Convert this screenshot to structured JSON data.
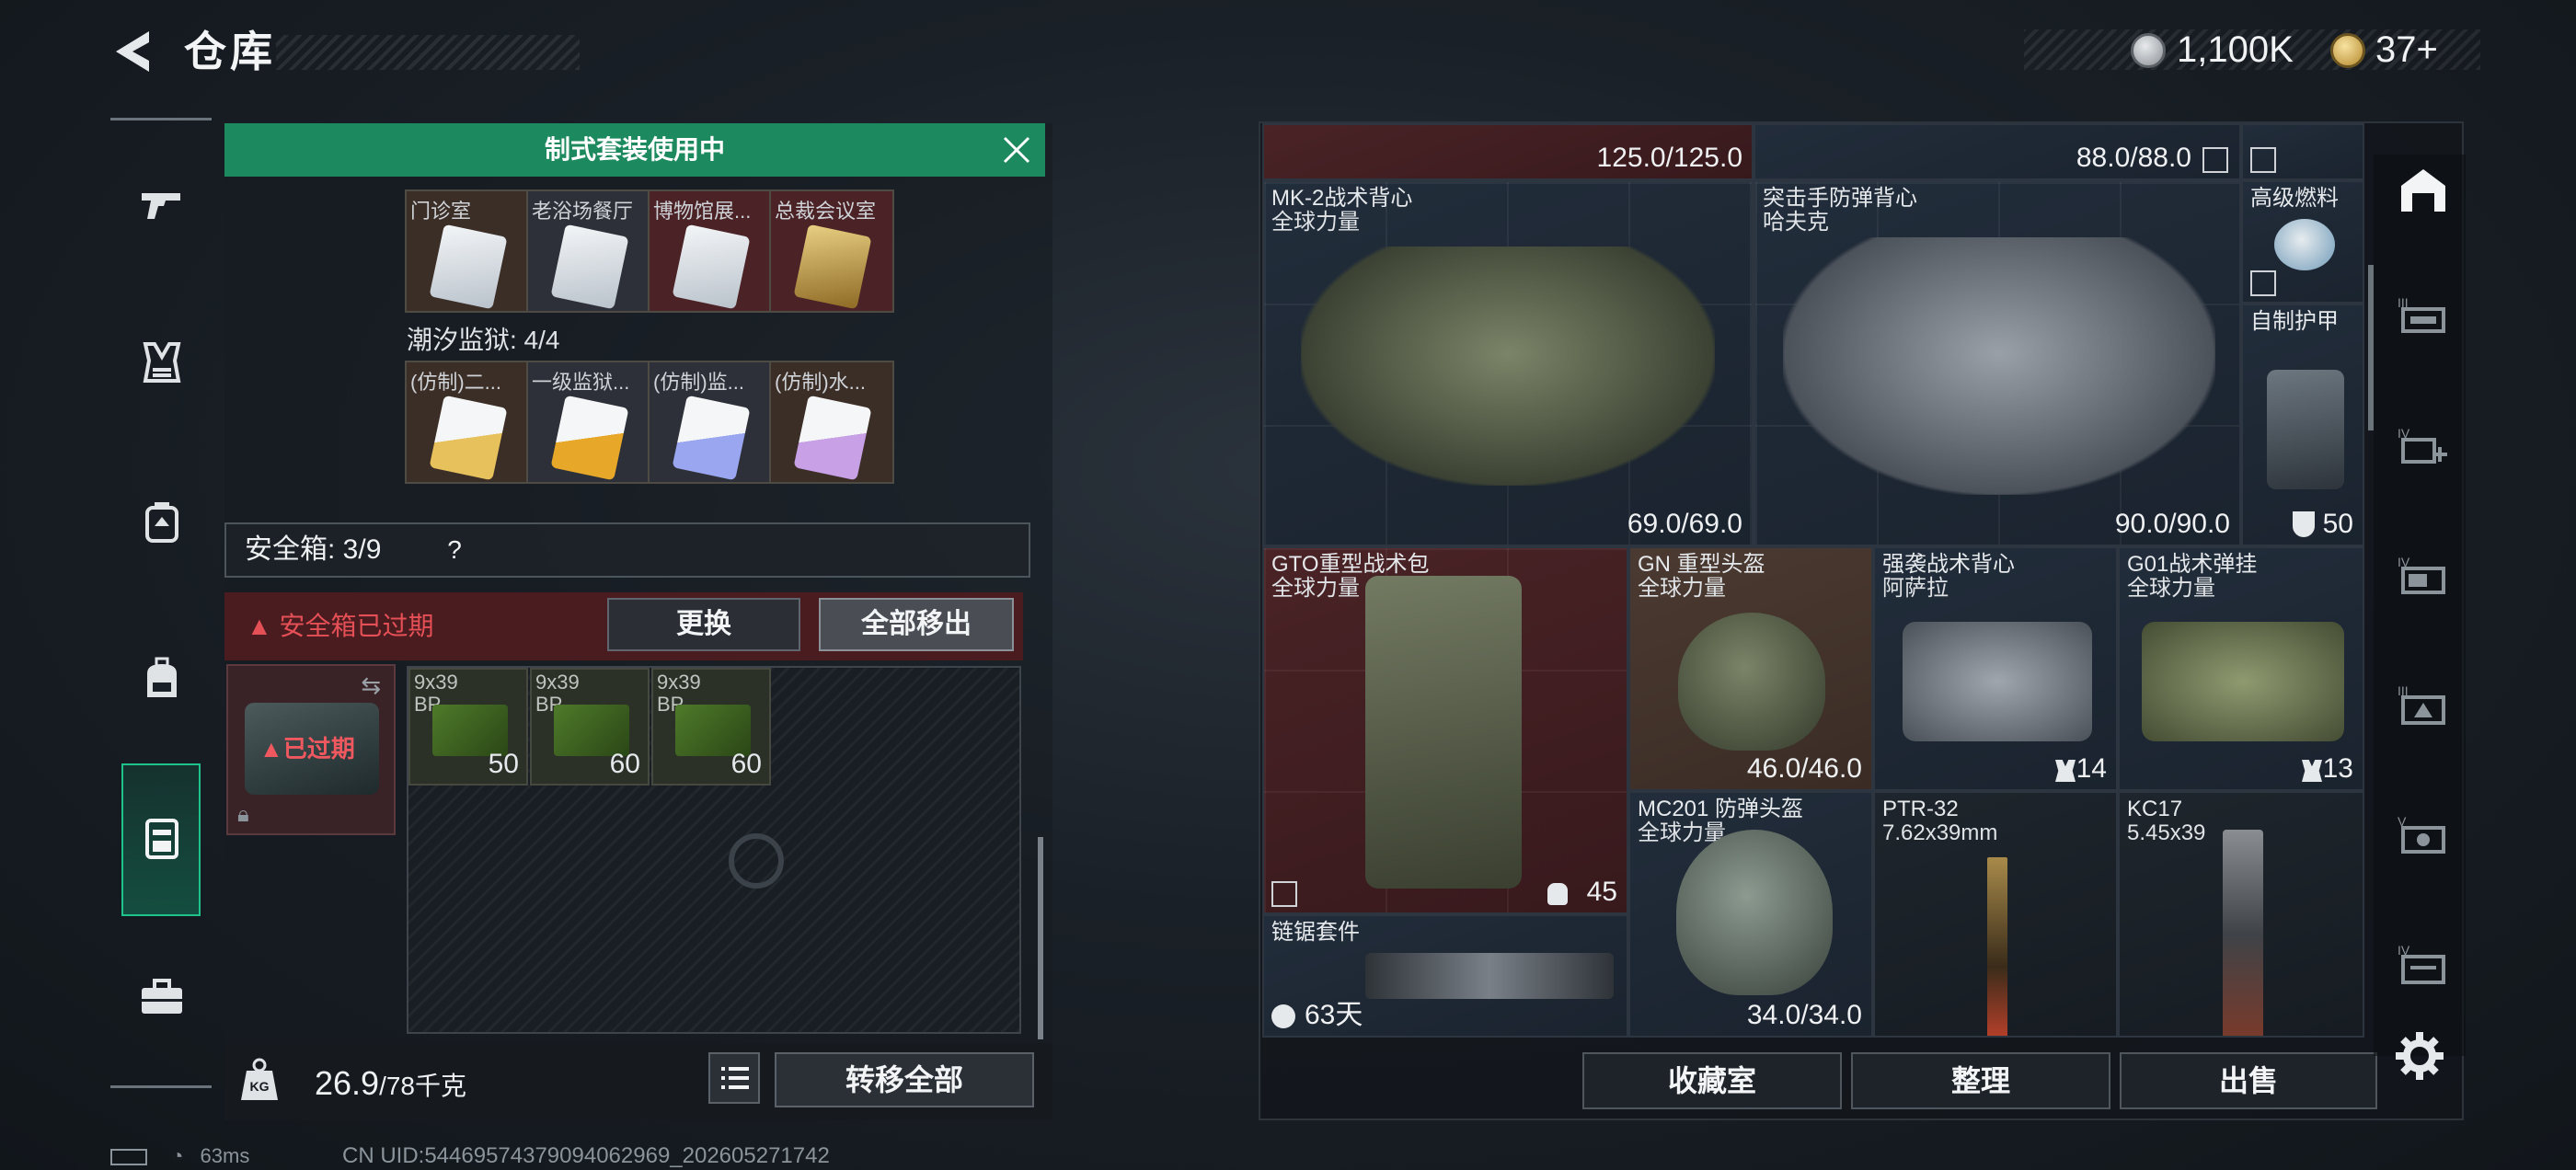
{
  "header": {
    "title": "仓库",
    "coins": "1,100K",
    "tokens": "37+"
  },
  "left_nav": {
    "items": [
      "gun-icon",
      "vest-icon",
      "armor-icon",
      "backpack-icon",
      "safe-case-icon",
      "toolbox-icon"
    ],
    "active": "safe-case-icon"
  },
  "banner": {
    "text": "制式套装使用中"
  },
  "keycards_top": [
    {
      "label": "门诊室",
      "color": "#d7dde2",
      "bg": "#3b2e27"
    },
    {
      "label": "老浴场餐厅",
      "color": "#d7dde2",
      "bg": "#2d3038"
    },
    {
      "label": "博物馆展...",
      "color": "#d7dde2",
      "bg": "#4b2226"
    },
    {
      "label": "总裁会议室",
      "color": "#d6b45a",
      "bg": "#4b2226"
    }
  ],
  "prison": {
    "label": "潮汐监狱: 4/4"
  },
  "keycards_bottom": [
    {
      "label": "(仿制)二...",
      "color": "#e7c15c",
      "bg": "#3b2e27"
    },
    {
      "label": "一级监狱...",
      "color": "#e7a82a",
      "bg": "#2d3038"
    },
    {
      "label": "(仿制)监...",
      "color": "#9aa6f0",
      "bg": "#2d3038"
    },
    {
      "label": "(仿制)水...",
      "color": "#c7a0e6",
      "bg": "#3b2e27"
    }
  ],
  "safebox": {
    "label": "安全箱: 3/9",
    "help": "?",
    "expired_msg": "安全箱已过期",
    "replace": "更换",
    "remove_all": "全部移出",
    "case_status": "已过期"
  },
  "ammo": [
    {
      "label": "9x39\nBP",
      "count": "50"
    },
    {
      "label": "9x39\nBP",
      "count": "60"
    },
    {
      "label": "9x39\nBP",
      "count": "60"
    }
  ],
  "bottom_left": {
    "weight": "26.9",
    "weight_max": "/78千克",
    "transfer_all": "转移全部"
  },
  "items": {
    "top1_val": "125.0/125.0",
    "top2_val": "88.0/88.0",
    "vest1_name": "MK-2战术背心",
    "vest1_sub": "全球力量",
    "vest1_val": "69.0/69.0",
    "vest2_name": "突击手防弹背心",
    "vest2_sub": "哈夫克",
    "vest2_val": "90.0/90.0",
    "fuel_name": "高级燃料",
    "armor_self_name": "自制护甲",
    "armor_self_val": "50",
    "gto_name": "GTO重型战术包",
    "gto_sub": "全球力量",
    "gto_val": "45",
    "gn_name": "GN 重型头盔",
    "gn_sub": "全球力量",
    "gn_val": "46.0/46.0",
    "qx_name": "强袭战术背心",
    "qx_sub": "阿萨拉",
    "qx_val": "14",
    "g01_name": "G01战术弹挂",
    "g01_sub": "全球力量",
    "g01_val": "13",
    "mc_name": "MC201 防弹头盔",
    "mc_sub": "全球力量",
    "mc_val": "34.0/34.0",
    "ptr_name": "PTR-32",
    "ptr_sub": "7.62x39mm",
    "kc_name": "KC17",
    "kc_sub": "5.45x39",
    "saw_name": "链锯套件",
    "saw_val": "63天"
  },
  "actions": {
    "collection": "收藏室",
    "organize": "整理",
    "sell": "出售"
  },
  "status": {
    "ping": "63ms",
    "uid": "CN UID:5446957437909406296​9_202605271742"
  },
  "colors": {
    "accent_green": "#1c8a5e",
    "danger_red": "#e45056"
  }
}
